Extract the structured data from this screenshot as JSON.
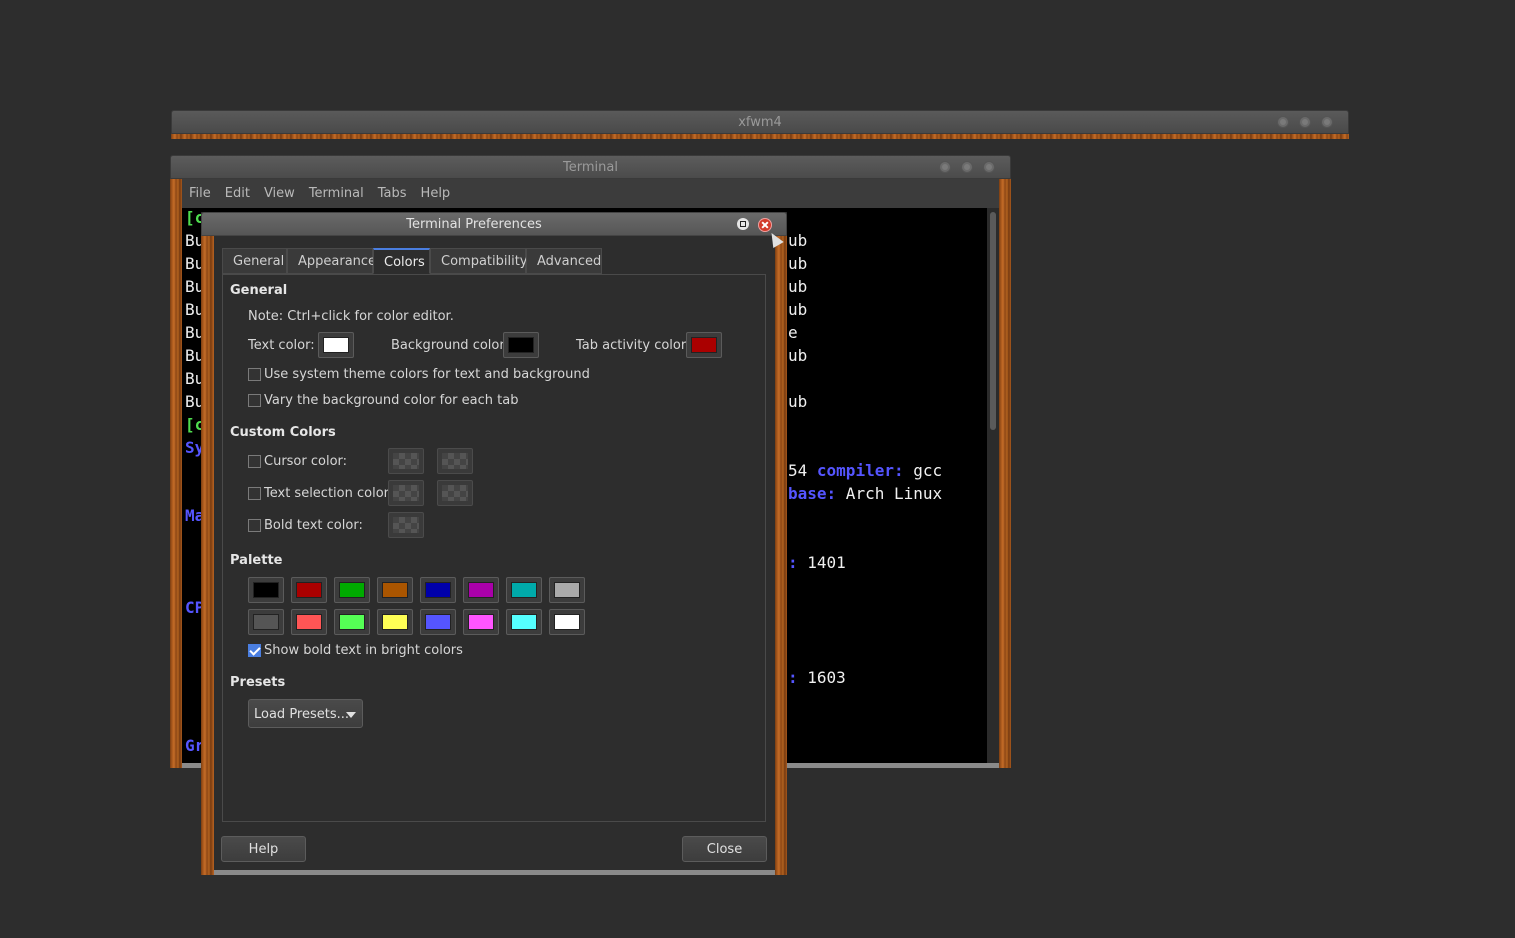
{
  "desktop": {
    "background": "#2d2d2d"
  },
  "xfwm_window": {
    "title": "xfwm4"
  },
  "terminal_window": {
    "title": "Terminal",
    "menu": [
      "File",
      "Edit",
      "View",
      "Terminal",
      "Tabs",
      "Help"
    ],
    "left_fragments": [
      "[c",
      "Bu",
      "Bu",
      "Bu",
      "Bu",
      "Bu",
      "Bu",
      "Bu",
      "Bu",
      "[c",
      "Sy",
      "Ma",
      "CP",
      "Gr"
    ],
    "right_fragments": {
      "r1": "ub",
      "r2": "ub",
      "r3": "ub",
      "r4": "ub",
      "r5": "e",
      "r6": "ub",
      "r7": "ub",
      "compiler_prefix": "54 ",
      "compiler_label": "compiler:",
      "compiler_value": " gcc",
      "base_label": "base:",
      "base_value": " Arch Linux",
      "v1_label": ":",
      "v1_value": " 1401",
      "v2_label": ":",
      "v2_value": " 1603"
    }
  },
  "preferences": {
    "title": "Terminal Preferences",
    "tabs": [
      "General",
      "Appearance",
      "Colors",
      "Compatibility",
      "Advanced"
    ],
    "active_tab": "Colors",
    "general": {
      "heading": "General",
      "note": "Note: Ctrl+click for color editor.",
      "text_color_label": "Text color:",
      "text_color": "#ffffff",
      "background_color_label": "Background color:",
      "background_color": "#000000",
      "tab_activity_color_label": "Tab activity color:",
      "tab_activity_color": "#aa0000",
      "use_system_theme_label": "Use system theme colors for text and background",
      "use_system_theme_checked": false,
      "vary_bg_label": "Vary the background color for each tab",
      "vary_bg_checked": false
    },
    "custom_colors": {
      "heading": "Custom Colors",
      "cursor_color_label": "Cursor color:",
      "text_selection_color_label": "Text selection color:",
      "bold_text_color_label": "Bold text color:"
    },
    "palette": {
      "heading": "Palette",
      "row1": [
        "#000000",
        "#aa0000",
        "#00aa00",
        "#aa5500",
        "#0000aa",
        "#aa00aa",
        "#00aaaa",
        "#aaaaaa"
      ],
      "row2": [
        "#555555",
        "#ff5555",
        "#55ff55",
        "#ffff55",
        "#5555ff",
        "#ff55ff",
        "#55ffff",
        "#ffffff"
      ],
      "show_bold_label": "Show bold text in bright colors",
      "show_bold_checked": true
    },
    "presets": {
      "heading": "Presets",
      "load_label": "Load Presets..."
    },
    "buttons": {
      "help": "Help",
      "close": "Close"
    }
  }
}
